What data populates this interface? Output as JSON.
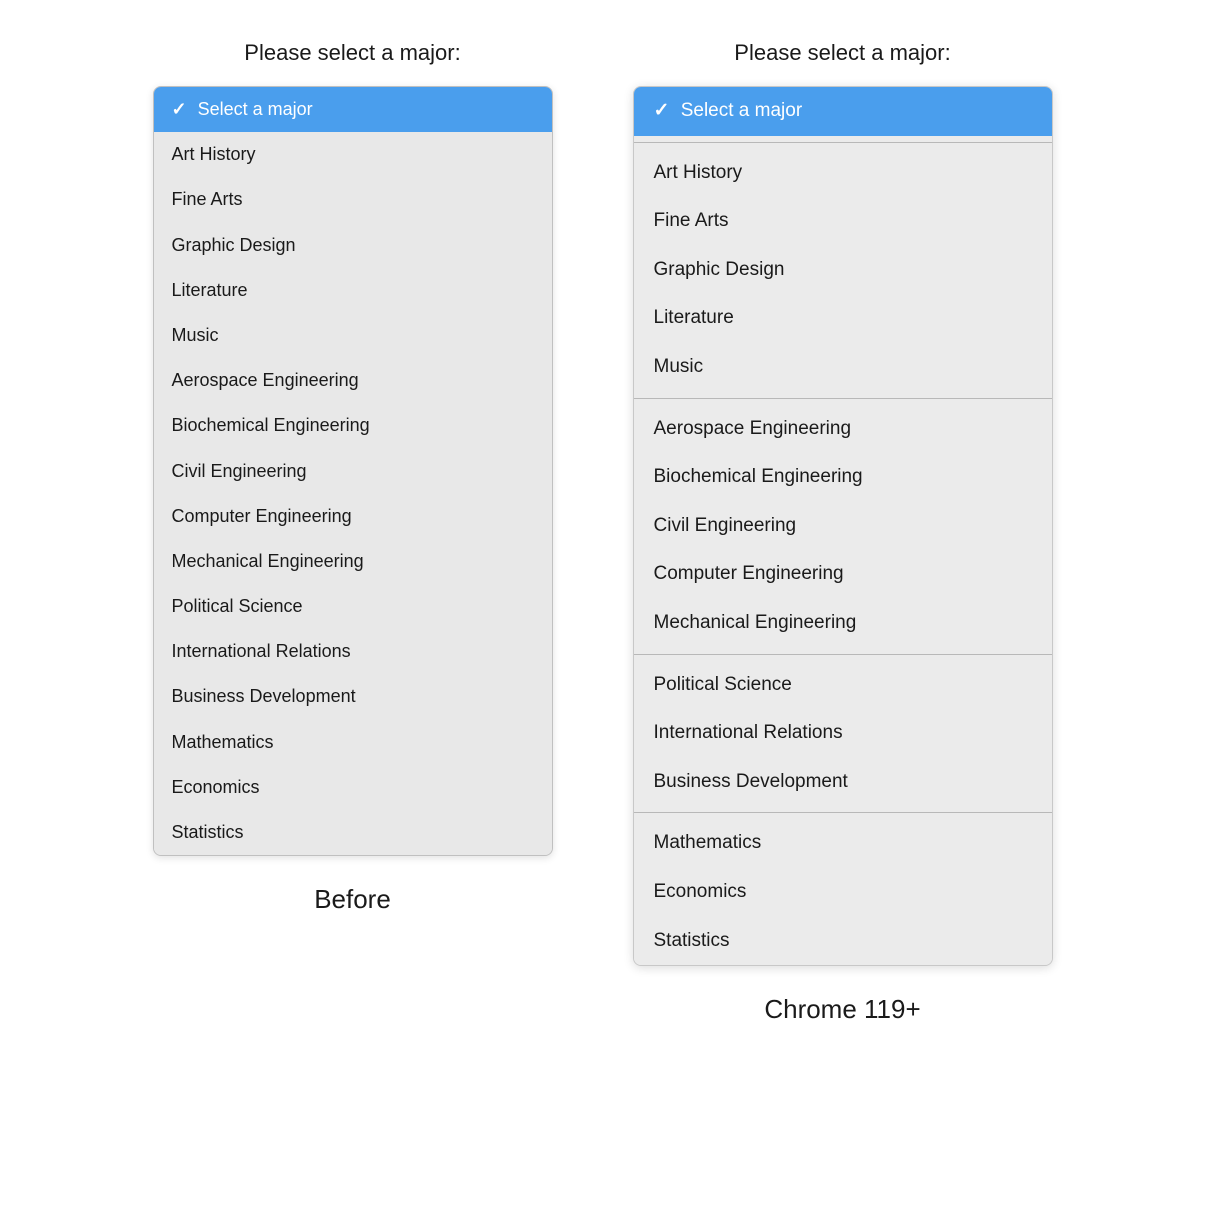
{
  "left": {
    "label": "Please select a major:",
    "footer": "Before",
    "selected_item": "Select a major",
    "items": [
      {
        "id": "select-placeholder",
        "text": "Select a major",
        "selected": true
      },
      {
        "id": "art-history",
        "text": "Art History",
        "selected": false
      },
      {
        "id": "fine-arts",
        "text": "Fine Arts",
        "selected": false
      },
      {
        "id": "graphic-design",
        "text": "Graphic Design",
        "selected": false
      },
      {
        "id": "literature",
        "text": "Literature",
        "selected": false
      },
      {
        "id": "music",
        "text": "Music",
        "selected": false
      },
      {
        "id": "aerospace-engineering",
        "text": "Aerospace Engineering",
        "selected": false
      },
      {
        "id": "biochemical-engineering",
        "text": "Biochemical Engineering",
        "selected": false
      },
      {
        "id": "civil-engineering",
        "text": "Civil Engineering",
        "selected": false
      },
      {
        "id": "computer-engineering",
        "text": "Computer Engineering",
        "selected": false
      },
      {
        "id": "mechanical-engineering",
        "text": "Mechanical Engineering",
        "selected": false
      },
      {
        "id": "political-science",
        "text": "Political Science",
        "selected": false
      },
      {
        "id": "international-relations",
        "text": "International Relations",
        "selected": false
      },
      {
        "id": "business-development",
        "text": "Business Development",
        "selected": false
      },
      {
        "id": "mathematics",
        "text": "Mathematics",
        "selected": false
      },
      {
        "id": "economics",
        "text": "Economics",
        "selected": false
      },
      {
        "id": "statistics",
        "text": "Statistics",
        "selected": false
      }
    ]
  },
  "right": {
    "label": "Please select a major:",
    "footer": "Chrome 119+",
    "selected_item": "Select a major",
    "groups": [
      {
        "id": "group-selected",
        "items": [
          {
            "id": "select-placeholder",
            "text": "Select a major",
            "selected": true
          }
        ]
      },
      {
        "id": "group-arts",
        "items": [
          {
            "id": "art-history",
            "text": "Art History",
            "selected": false
          },
          {
            "id": "fine-arts",
            "text": "Fine Arts",
            "selected": false
          },
          {
            "id": "graphic-design",
            "text": "Graphic Design",
            "selected": false
          },
          {
            "id": "literature",
            "text": "Literature",
            "selected": false
          },
          {
            "id": "music",
            "text": "Music",
            "selected": false
          }
        ]
      },
      {
        "id": "group-engineering",
        "items": [
          {
            "id": "aerospace-engineering",
            "text": "Aerospace Engineering",
            "selected": false
          },
          {
            "id": "biochemical-engineering",
            "text": "Biochemical Engineering",
            "selected": false
          },
          {
            "id": "civil-engineering",
            "text": "Civil Engineering",
            "selected": false
          },
          {
            "id": "computer-engineering",
            "text": "Computer Engineering",
            "selected": false
          },
          {
            "id": "mechanical-engineering",
            "text": "Mechanical Engineering",
            "selected": false
          }
        ]
      },
      {
        "id": "group-social",
        "items": [
          {
            "id": "political-science",
            "text": "Political Science",
            "selected": false
          },
          {
            "id": "international-relations",
            "text": "International Relations",
            "selected": false
          },
          {
            "id": "business-development",
            "text": "Business Development",
            "selected": false
          }
        ]
      },
      {
        "id": "group-math",
        "items": [
          {
            "id": "mathematics",
            "text": "Mathematics",
            "selected": false
          },
          {
            "id": "economics",
            "text": "Economics",
            "selected": false
          },
          {
            "id": "statistics",
            "text": "Statistics",
            "selected": false
          }
        ]
      }
    ]
  },
  "checkmark": "✓"
}
